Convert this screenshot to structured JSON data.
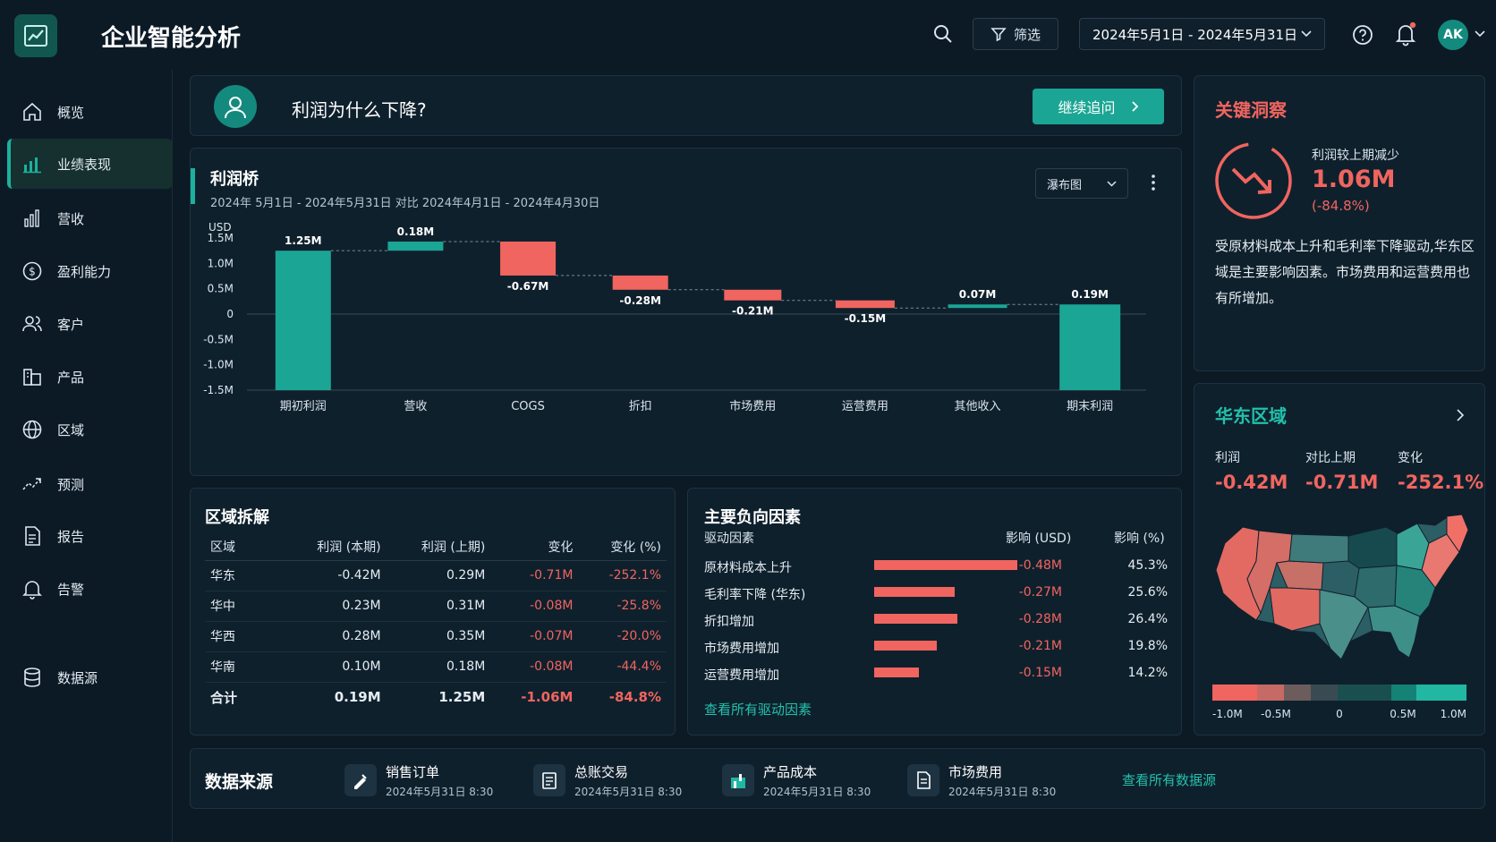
{
  "app": {
    "title": "企业智能分析"
  },
  "topbar": {
    "filter_label": "筛选",
    "date_range": "2024年5月1日 - 2024年5月31日",
    "avatar_initials": "AK"
  },
  "sidebar": {
    "items": [
      {
        "label": "概览",
        "icon": "home-icon"
      },
      {
        "label": "业绩表现",
        "icon": "bar-chart-icon",
        "active": true
      },
      {
        "label": "营收",
        "icon": "revenue-chart-icon"
      },
      {
        "label": "盈利能力",
        "icon": "dollar-circle-icon"
      },
      {
        "label": "客户",
        "icon": "users-icon"
      },
      {
        "label": "产品",
        "icon": "product-icon"
      },
      {
        "label": "区域",
        "icon": "globe-icon"
      },
      {
        "label": "预测",
        "icon": "forecast-icon"
      },
      {
        "label": "报告",
        "icon": "report-icon"
      },
      {
        "label": "告警",
        "icon": "bell-icon"
      },
      {
        "label": "数据源",
        "icon": "database-icon"
      }
    ]
  },
  "question": {
    "text": "利润为什么下降?",
    "button_label": "继续追问"
  },
  "bridge": {
    "title": "利润桥",
    "subtitle": "2024年 5月1日 - 2024年5月31日   对比 2024年4月1日 - 2024年4月30日",
    "chart_type_label": "瀑布图"
  },
  "chart_data": {
    "type": "bar",
    "subtype": "waterfall",
    "title": "利润桥",
    "ylabel": "USD",
    "ylim": [
      -1.5,
      1.5
    ],
    "yticks": [
      "1.5M",
      "1.0M",
      "0.5M",
      "0",
      "-0.5M",
      "-1.0M",
      "-1.5M"
    ],
    "categories": [
      "期初利润",
      "营收",
      "COGS",
      "折扣",
      "市场费用",
      "运营费用",
      "其他收入",
      "期末利润"
    ],
    "values": [
      1.25,
      0.18,
      -0.67,
      -0.28,
      -0.21,
      -0.15,
      0.07,
      0.19
    ],
    "labels": [
      "1.25M",
      "0.18M",
      "-0.67M",
      "-0.28M",
      "-0.21M",
      "-0.15M",
      "0.07M",
      "0.19M"
    ],
    "totals": [
      true,
      false,
      false,
      false,
      false,
      false,
      false,
      true
    ],
    "colors": {
      "positive": "#1ba594",
      "negative": "#f0655f"
    },
    "grid": false
  },
  "insight": {
    "title": "关键洞察",
    "caption": "利润较上期减少",
    "value": "1.06M",
    "pct": "(-84.8%)",
    "body": "受原材料成本上升和毛利率下降驱动,华东区域是主要影响因素。市场费用和运营费用也有所增加。"
  },
  "region": {
    "title": "华东区域",
    "stats": [
      {
        "label": "利润",
        "value": "-0.42M"
      },
      {
        "label": "对比上期",
        "value": "-0.71M"
      },
      {
        "label": "变化",
        "value": "-252.1%"
      }
    ],
    "legend_ticks": [
      "-1.0M",
      "-0.5M",
      "0",
      "0.5M",
      "1.0M"
    ]
  },
  "breakdown": {
    "title": "区域拆解",
    "columns": [
      "区域",
      "利润 (本期)",
      "利润 (上期)",
      "变化",
      "变化 (%)"
    ],
    "rows": [
      [
        "华东",
        "-0.42M",
        "0.29M",
        "-0.71M",
        "-252.1%"
      ],
      [
        "华中",
        "0.23M",
        "0.31M",
        "-0.08M",
        "-25.8%"
      ],
      [
        "华西",
        "0.28M",
        "0.35M",
        "-0.07M",
        "-20.0%"
      ],
      [
        "华南",
        "0.10M",
        "0.18M",
        "-0.08M",
        "-44.4%"
      ],
      [
        "合计",
        "0.19M",
        "1.25M",
        "-1.06M",
        "-84.8%"
      ]
    ]
  },
  "drivers": {
    "title": "主要负向因素",
    "col_driver": "驱动因素",
    "col_impact": "影响 (USD)",
    "col_pct": "影响 (%)",
    "rows": [
      {
        "label": "原材料成本上升",
        "value": "-0.48M",
        "pct": "45.3%",
        "share": 0.453
      },
      {
        "label": "毛利率下降 (华东)",
        "value": "-0.27M",
        "pct": "25.6%",
        "share": 0.256
      },
      {
        "label": "折扣增加",
        "value": "-0.28M",
        "pct": "26.4%",
        "share": 0.264
      },
      {
        "label": "市场费用增加",
        "value": "-0.21M",
        "pct": "19.8%",
        "share": 0.198
      },
      {
        "label": "运营费用增加",
        "value": "-0.15M",
        "pct": "14.2%",
        "share": 0.142
      }
    ],
    "link": "查看所有驱动因素"
  },
  "sources": {
    "title": "数据来源",
    "items": [
      {
        "name": "销售订单",
        "time": "2024年5月31日 8:30",
        "icon": "sales-order-icon"
      },
      {
        "name": "总账交易",
        "time": "2024年5月31日 8:30",
        "icon": "ledger-icon"
      },
      {
        "name": "产品成本",
        "time": "2024年5月31日 8:30",
        "icon": "product-cost-icon"
      },
      {
        "name": "市场费用",
        "time": "2024年5月31日 8:30",
        "icon": "document-icon"
      }
    ],
    "link": "查看所有数据源"
  },
  "colors": {
    "accent": "#1ba594",
    "negative": "#f0655f",
    "background": "#0c1a26",
    "panel": "#0f202d"
  }
}
